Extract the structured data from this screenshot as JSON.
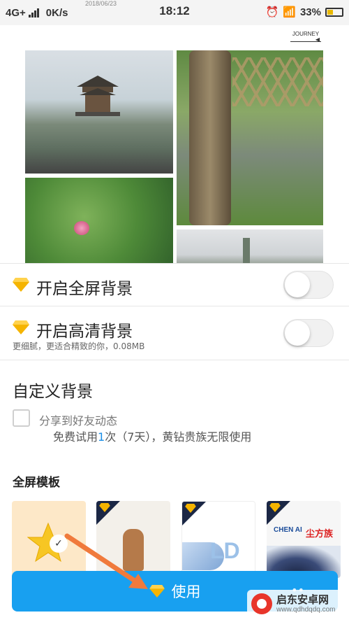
{
  "status_bar": {
    "network": "4G+",
    "speed": "0K/s",
    "time": "18:12",
    "battery": "33%",
    "date_ghost": "2018/06/23"
  },
  "header": {
    "journey_label": "JOURNEY"
  },
  "fullscreen_bg": {
    "label": "开启全屏背景",
    "enabled": false
  },
  "hd_bg": {
    "label": "开启高清背景",
    "sub": "更细腻，更适合精致的你，0.08MB",
    "enabled": false
  },
  "custom_bg": {
    "title": "自定义背景",
    "share_label": "分享到好友动态",
    "trial_prefix": "免费试用",
    "trial_count": "1",
    "trial_suffix": "次（7天），黄钻贵族无限使用",
    "share_checked": false
  },
  "templates": {
    "title": "全屏模板",
    "t3_text": "LD",
    "t4_text_en": "CHEN AI",
    "t4_text_cn": "尘方族"
  },
  "use_button": {
    "label": "使用"
  },
  "watermark": {
    "name": "启东安卓网",
    "url": "www.qdhdqdq.com"
  },
  "colors": {
    "accent": "#18a0f0",
    "diamond": "#f5b400",
    "annotation_arrow": "#f07a3c"
  },
  "icons": [
    "diamond-icon",
    "check-icon",
    "wifi-icon",
    "alarm-icon",
    "battery-icon"
  ]
}
